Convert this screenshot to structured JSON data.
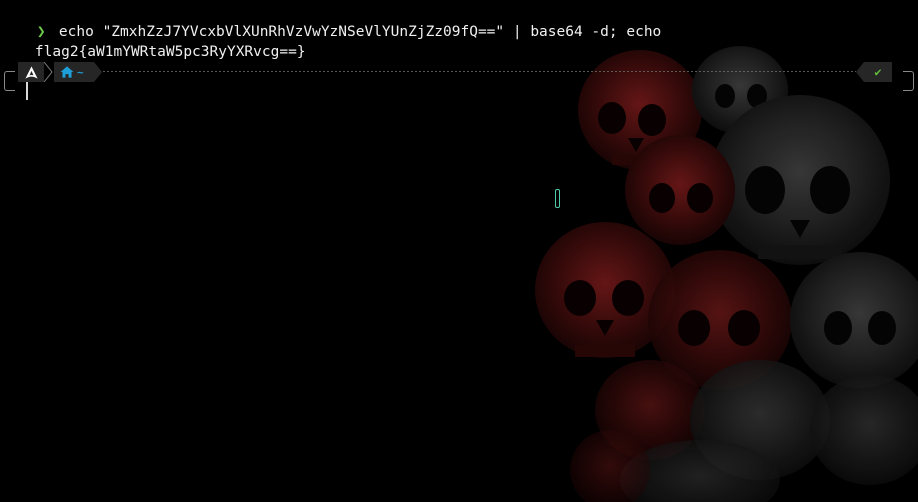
{
  "terminal": {
    "prompt_symbol": "❯",
    "command": "echo \"ZmxhZzJ7YVcxbVlXUnRhVzVwYzNSeVlYUnZjZz09fQ==\" | base64 -d; echo",
    "output": "flag2{aW1mYWRtaW5pc3RyYXRvcg==}"
  },
  "prompt_bar": {
    "os_icon": "arch-linux-icon",
    "dir_icon": "home-icon",
    "dir_label": "~",
    "status_icon": "checkmark-icon",
    "status_text": "✔"
  },
  "colors": {
    "background": "#000000",
    "prompt_chevron": "#6fc94b",
    "segment_bg": "#262626",
    "dir_accent": "#1e9fd8",
    "status_ok": "#5fbf3a",
    "wallpaper_tint": "#5a1212"
  },
  "wallpaper": {
    "subject": "pile-of-skulls"
  }
}
